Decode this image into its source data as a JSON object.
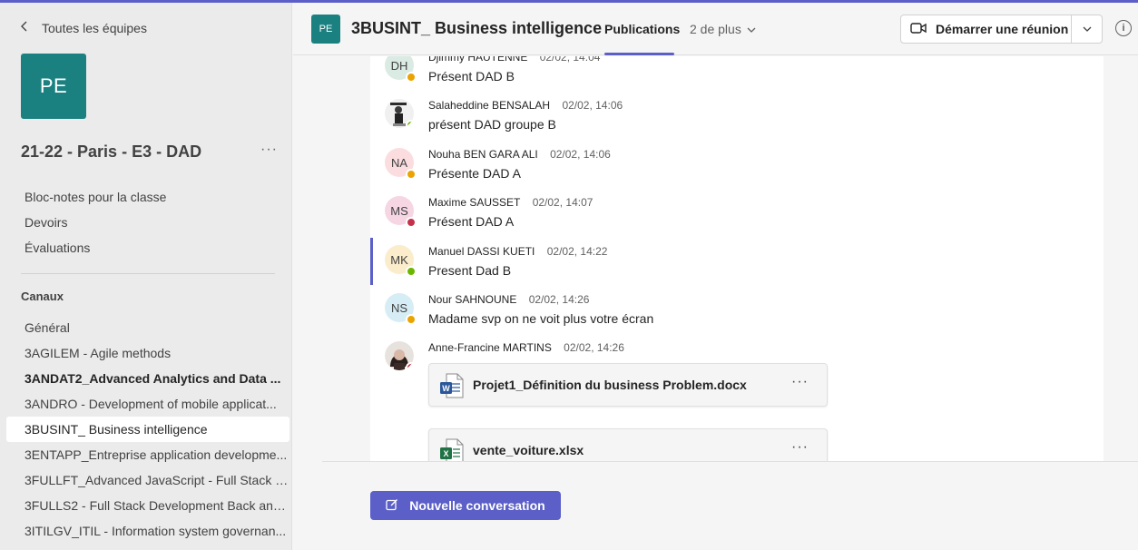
{
  "accent_color": "#5b5fc7",
  "team_color": "#1b8180",
  "sidebar": {
    "back_label": "Toutes les équipes",
    "team_initials": "PE",
    "team_name": "21-22 - Paris - E3 - DAD",
    "more": "···",
    "links": [
      "Bloc-notes pour la classe",
      "Devoirs",
      "Évaluations"
    ],
    "channels_title": "Canaux",
    "channels": [
      "Général",
      "3AGILEM - Agile methods",
      "3ANDAT2_Advanced Analytics and Data ...",
      "3ANDRO - Development of mobile applicat...",
      "3BUSINT_ Business intelligence",
      "3ENTAPP_Entreprise application developme...",
      "3FULLFT_Advanced JavaScript - Full Stack D...",
      "3FULLS2 - Full Stack Development Back and...",
      "3ITILGV_ITIL - Information system governan..."
    ]
  },
  "header": {
    "team_initials": "PE",
    "channel_title": "3BUSINT_ Business intelligence",
    "tab_active": "Publications",
    "tab_more": "2 de plus",
    "meet_label": "Démarrer une réunion",
    "info": "i"
  },
  "posts": [
    {
      "initials": "DH",
      "name": "Djimmy HAUTENNE",
      "time": "02/02, 14:04",
      "text": "Présent DAD B"
    },
    {
      "initials": "",
      "name": "Salaheddine BENSALAH",
      "time": "02/02, 14:06",
      "text": "présent DAD groupe B"
    },
    {
      "initials": "NA",
      "name": "Nouha BEN GARA ALI",
      "time": "02/02, 14:06",
      "text": "Présente DAD A"
    },
    {
      "initials": "MS",
      "name": "Maxime SAUSSET",
      "time": "02/02, 14:07",
      "text": "Présent DAD A"
    },
    {
      "initials": "MK",
      "name": "Manuel DASSI KUETI",
      "time": "02/02, 14:22",
      "text": "Present Dad B"
    },
    {
      "initials": "NS",
      "name": "Nour SAHNOUNE",
      "time": "02/02, 14:26",
      "text": "Madame svp on ne voit plus votre écran"
    },
    {
      "initials": "",
      "name": "Anne-Francine MARTINS",
      "time": "02/02, 14:26",
      "text": ""
    }
  ],
  "files": [
    {
      "name": "Projet1_Définition du business Problem.docx",
      "icon": "word-icon",
      "more": "···"
    },
    {
      "name": "vente_voiture.xlsx",
      "icon": "excel-icon",
      "more": "···"
    }
  ],
  "footer": {
    "new_conversation": "Nouvelle conversation"
  }
}
